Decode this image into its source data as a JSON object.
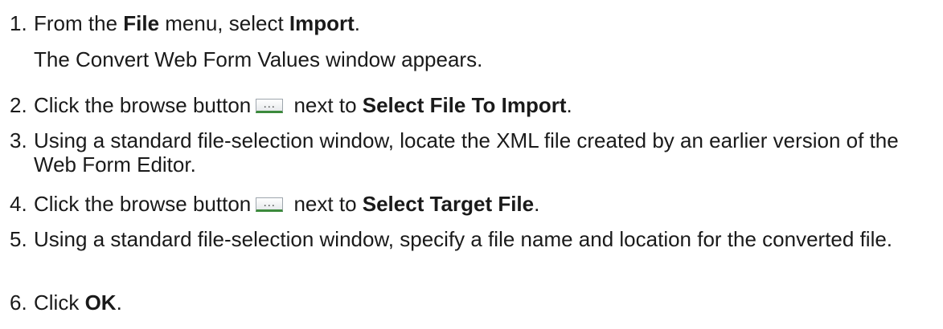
{
  "steps": [
    {
      "number": "1.",
      "t1": "From the ",
      "b1": "File",
      "t2": " menu, select ",
      "b2": "Import",
      "t3": ".",
      "note": "The Convert Web Form Values window appears."
    },
    {
      "number": "2.",
      "t1": "Click the browse button",
      "t2": " next to ",
      "b1": "Select File To Import",
      "t3": "."
    },
    {
      "number": "3.",
      "text": "Using a standard file-selection window, locate the XML file created by an earlier version of the Web Form Editor."
    },
    {
      "number": "4.",
      "t1": "Click the browse button",
      "t2": " next to ",
      "b1": "Select Target File",
      "t3": "."
    },
    {
      "number": "5.",
      "text": "Using a standard file-selection window, specify a file name and location for the converted file."
    },
    {
      "number": "6.",
      "t1": "Click ",
      "b1": "OK",
      "t2": "."
    }
  ],
  "browse_button": {
    "glyph": "…",
    "icon": "browse-ellipsis-icon"
  }
}
